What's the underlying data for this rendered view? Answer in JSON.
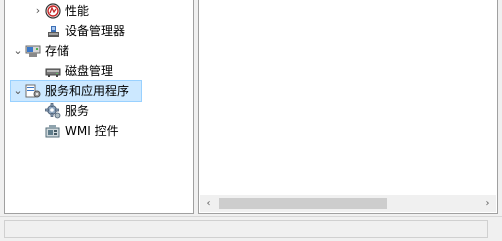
{
  "tree": {
    "items": [
      {
        "label": "性能",
        "icon": "performance-icon",
        "expander": "›",
        "level": 2
      },
      {
        "label": "设备管理器",
        "icon": "device-manager-icon",
        "expander": "",
        "level": 2
      },
      {
        "label": "存储",
        "icon": "storage-icon",
        "expander": "⌄",
        "level": 1
      },
      {
        "label": "磁盘管理",
        "icon": "disk-management-icon",
        "expander": "",
        "level": 2
      },
      {
        "label": "服务和应用程序",
        "icon": "services-and-applications-icon",
        "expander": "⌄",
        "level": 1,
        "selected": true
      },
      {
        "label": "服务",
        "icon": "services-gear-icon",
        "expander": "",
        "level": 2
      },
      {
        "label": "WMI 控件",
        "icon": "wmi-control-icon",
        "expander": "",
        "level": 2
      }
    ]
  },
  "content": {
    "scroll_left": "‹",
    "scroll_right": "›"
  },
  "colors": {
    "selection": "#cce8ff",
    "selection_border": "#99d1ff",
    "pane_border": "#a0a0a0"
  }
}
